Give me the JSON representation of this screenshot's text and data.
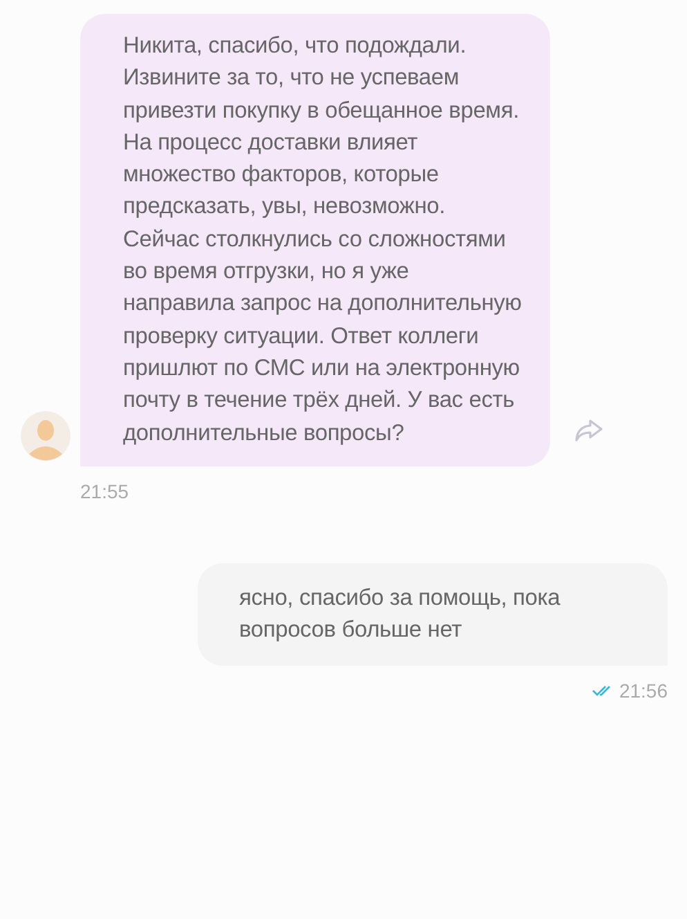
{
  "messages": [
    {
      "kind": "incoming",
      "text": "Никита, спасибо, что подождали. Извините за то, что не успеваем привезти покупку в обещанное время. На процесс доставки влияет множество факторов, которые предсказать, увы, невозможно. Сейчас столкнулись со сложностями во время отгрузки, но я уже направила запрос на дополнительную проверку ситуации. Ответ коллеги пришлют по СМС или на электронную почту в течение трёх дней. У вас есть дополнительные вопросы?",
      "time": "21:55"
    },
    {
      "kind": "outgoing",
      "text": "ясно, спасибо за помощь, пока вопросов больше нет",
      "time": "21:56",
      "read": true
    }
  ]
}
